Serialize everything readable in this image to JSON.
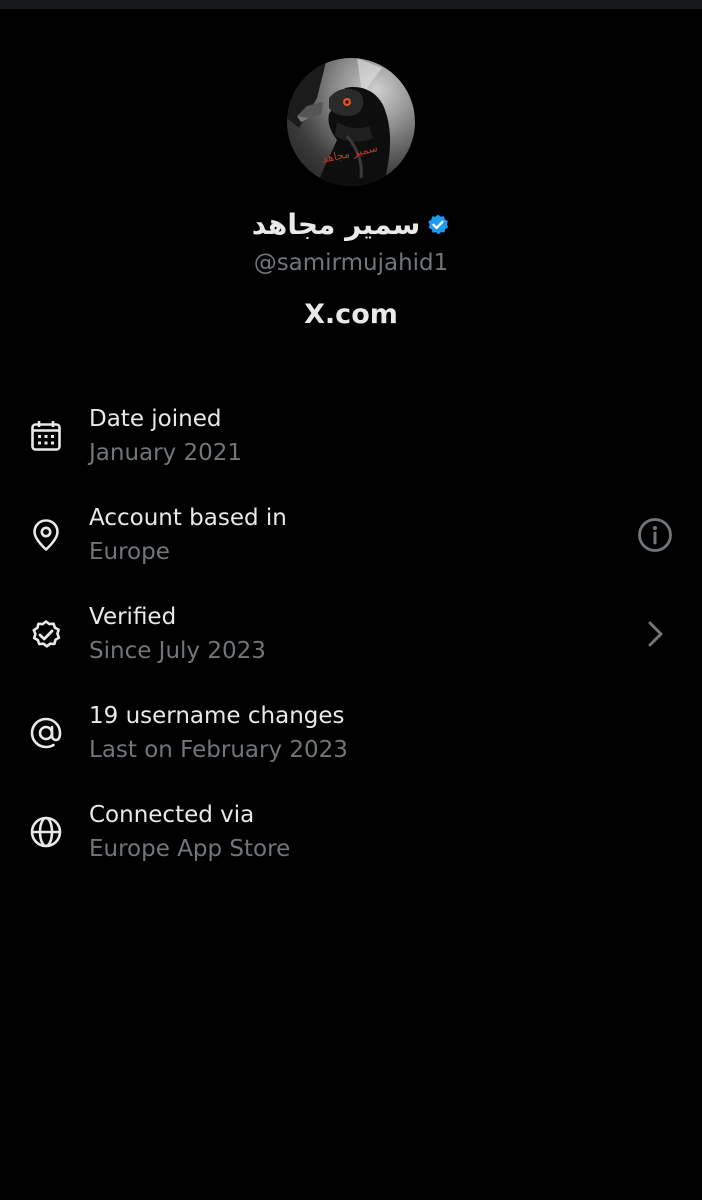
{
  "profile": {
    "display_name": "سمير مجاهد",
    "handle": "@samirmujahid1",
    "site": "X.com",
    "avatar_caption": "سمير مجاهد"
  },
  "colors": {
    "background": "#000000",
    "text_primary": "#e7e9ea",
    "text_secondary": "#71767b",
    "verified_blue": "#1d9bf0"
  },
  "info_rows": [
    {
      "title": "Date joined",
      "subtitle": "January 2021",
      "icon": "calendar-icon",
      "action": ""
    },
    {
      "title": "Account based in",
      "subtitle": "Europe",
      "icon": "location-pin-icon",
      "action": "info-icon"
    },
    {
      "title": "Verified",
      "subtitle": "Since July 2023",
      "icon": "verified-check-icon",
      "action": "chevron-right-icon"
    },
    {
      "title": "19 username changes",
      "subtitle": "Last on February 2023",
      "icon": "at-sign-icon",
      "action": ""
    },
    {
      "title": "Connected via",
      "subtitle": "Europe App Store",
      "icon": "globe-icon",
      "action": ""
    }
  ]
}
